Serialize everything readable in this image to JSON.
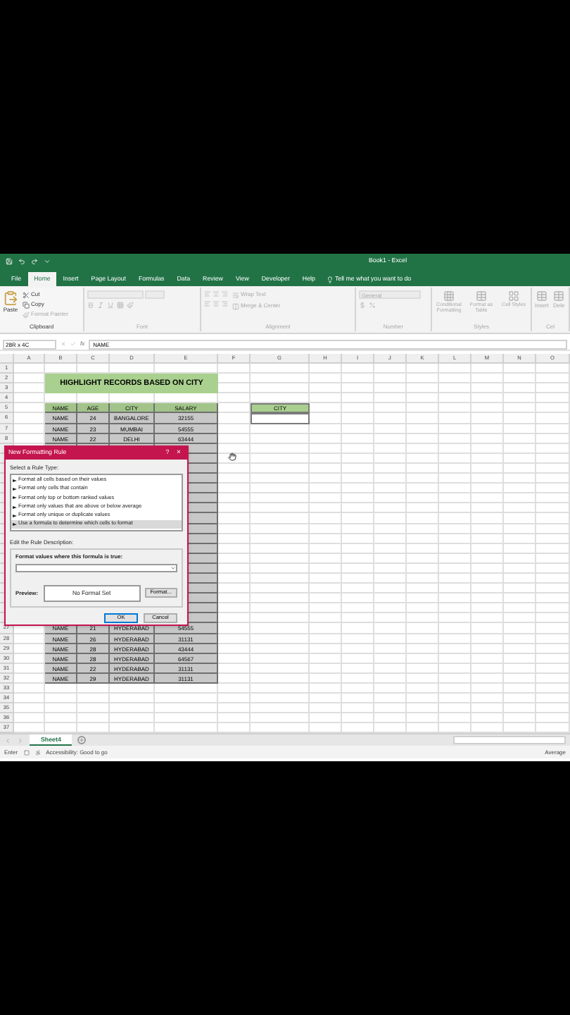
{
  "title_bar": {
    "title": "Book1 - Excel"
  },
  "ribbon_tabs": [
    {
      "label": "File",
      "selected": false
    },
    {
      "label": "Home",
      "selected": true
    },
    {
      "label": "Insert",
      "selected": false
    },
    {
      "label": "Page Layout",
      "selected": false
    },
    {
      "label": "Formulas",
      "selected": false
    },
    {
      "label": "Data",
      "selected": false
    },
    {
      "label": "Review",
      "selected": false
    },
    {
      "label": "View",
      "selected": false
    },
    {
      "label": "Developer",
      "selected": false
    },
    {
      "label": "Help",
      "selected": false
    }
  ],
  "tell_me": "Tell me what you want to do",
  "ribbon_groups": [
    {
      "label": "Clipboard",
      "kind": "clipboard",
      "disabled": false,
      "items": [
        "Paste",
        "Cut",
        "Copy",
        "Format Painter"
      ]
    },
    {
      "label": "Font",
      "kind": "font",
      "disabled": true
    },
    {
      "label": "Alignment",
      "kind": "alignment",
      "disabled": true,
      "items": [
        "Wrap Text",
        "Merge & Center"
      ]
    },
    {
      "label": "Number",
      "kind": "number",
      "disabled": true,
      "items": [
        "General"
      ]
    },
    {
      "label": "Styles",
      "kind": "styles",
      "disabled": true,
      "items": [
        "Conditional Formatting",
        "Format as Table",
        "Cell Styles"
      ]
    },
    {
      "label": "Cel",
      "kind": "cells",
      "disabled": true,
      "items": [
        "Insert",
        "Dele"
      ]
    }
  ],
  "formula_bar": {
    "name_box": "28R x 4C",
    "formula": "NAME",
    "function_label": "fx"
  },
  "columns": [
    "A",
    "B",
    "C",
    "D",
    "E",
    "F",
    "G",
    "H",
    "I",
    "J",
    "K",
    "L",
    "M",
    "N",
    "O"
  ],
  "rows": [
    {
      "header": "1",
      "kind": "blank"
    },
    {
      "header": "2",
      "kind": "title",
      "text": "HIGHLIGHT RECORDS BASED ON CITY"
    },
    {
      "header": "3",
      "kind": "title_cont"
    },
    {
      "header": "4",
      "kind": "blank"
    },
    {
      "header": "5",
      "kind": "header",
      "cells": [
        "NAME",
        "AGE",
        "CITY",
        "SALARY"
      ],
      "side_label": "CITY"
    },
    {
      "header": "6",
      "kind": "record",
      "cells": [
        "NAME",
        "24",
        "BANGALORE",
        "32155"
      ],
      "side_box": true
    },
    {
      "header": "7",
      "kind": "record",
      "cells": [
        "NAME",
        "23",
        "MUMBAI",
        "54555"
      ]
    },
    {
      "header": "8",
      "kind": "record",
      "cells": [
        "NAME",
        "22",
        "DELHI",
        "63444"
      ]
    },
    {
      "kind": "covered"
    },
    {
      "kind": "covered"
    },
    {
      "kind": "covered"
    },
    {
      "kind": "covered"
    },
    {
      "kind": "covered"
    },
    {
      "kind": "covered"
    },
    {
      "kind": "covered"
    },
    {
      "kind": "covered"
    },
    {
      "kind": "covered"
    },
    {
      "kind": "covered"
    },
    {
      "kind": "covered"
    },
    {
      "kind": "covered"
    },
    {
      "kind": "covered"
    },
    {
      "kind": "covered"
    },
    {
      "kind": "covered"
    },
    {
      "kind": "covered"
    },
    {
      "kind": "covered"
    },
    {
      "kind": "covered"
    },
    {
      "header": "27",
      "kind": "record",
      "cells": [
        "NAME",
        "21",
        "HYDERABAD",
        "54555"
      ]
    },
    {
      "header": "28",
      "kind": "record",
      "cells": [
        "NAME",
        "26",
        "HYDERABAD",
        "31131"
      ]
    },
    {
      "header": "29",
      "kind": "record",
      "cells": [
        "NAME",
        "28",
        "HYDERABAD",
        "43444"
      ]
    },
    {
      "header": "30",
      "kind": "record",
      "cells": [
        "NAME",
        "28",
        "HYDERABAD",
        "64567"
      ]
    },
    {
      "header": "31",
      "kind": "record",
      "cells": [
        "NAME",
        "22",
        "HYDERABAD",
        "31131"
      ]
    },
    {
      "header": "32",
      "kind": "record",
      "cells": [
        "NAME",
        "29",
        "HYDERABAD",
        "31131"
      ]
    },
    {
      "header": "33",
      "kind": "blank"
    },
    {
      "header": "34",
      "kind": "blank"
    },
    {
      "header": "35",
      "kind": "blank"
    },
    {
      "header": "36",
      "kind": "blank"
    },
    {
      "header": "37",
      "kind": "blank"
    }
  ],
  "dialog": {
    "title": "New Formatting Rule",
    "help": "?",
    "close": "×",
    "rule_type_label": "Select a Rule Type:",
    "rule_types": [
      {
        "label": "Format all cells based on their values",
        "selected": false
      },
      {
        "label": "Format only cells that contain",
        "selected": false
      },
      {
        "label": "Format only top or bottom ranked values",
        "selected": false
      },
      {
        "label": "Format only values that are above or below average",
        "selected": false
      },
      {
        "label": "Format only unique or duplicate values",
        "selected": false
      },
      {
        "label": "Use a formula to determine which cells to format",
        "selected": true
      }
    ],
    "description_label": "Edit the Rule Description:",
    "formula_label": "Format values where this formula is true:",
    "preview_label": "Preview:",
    "preview_text": "No Format Set",
    "format_button": "Format...",
    "buttons": [
      {
        "label": "OK",
        "default": true
      },
      {
        "label": "Cancel",
        "default": false
      }
    ]
  },
  "sheet_tabs": [
    {
      "label": "Sheet4",
      "selected": true
    }
  ],
  "status_bar": {
    "mode": "Enter",
    "accessibility": "Accessibility: Good to go",
    "summary": "Average"
  }
}
